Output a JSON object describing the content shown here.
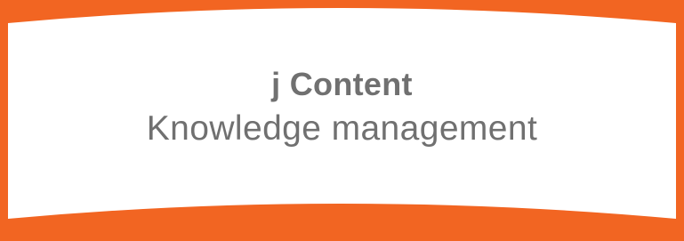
{
  "banner": {
    "title": "j Content",
    "subtitle": "Knowledge management",
    "accent_color": "#f26522",
    "background_color": "#ffffff",
    "text_color": "#707070"
  }
}
